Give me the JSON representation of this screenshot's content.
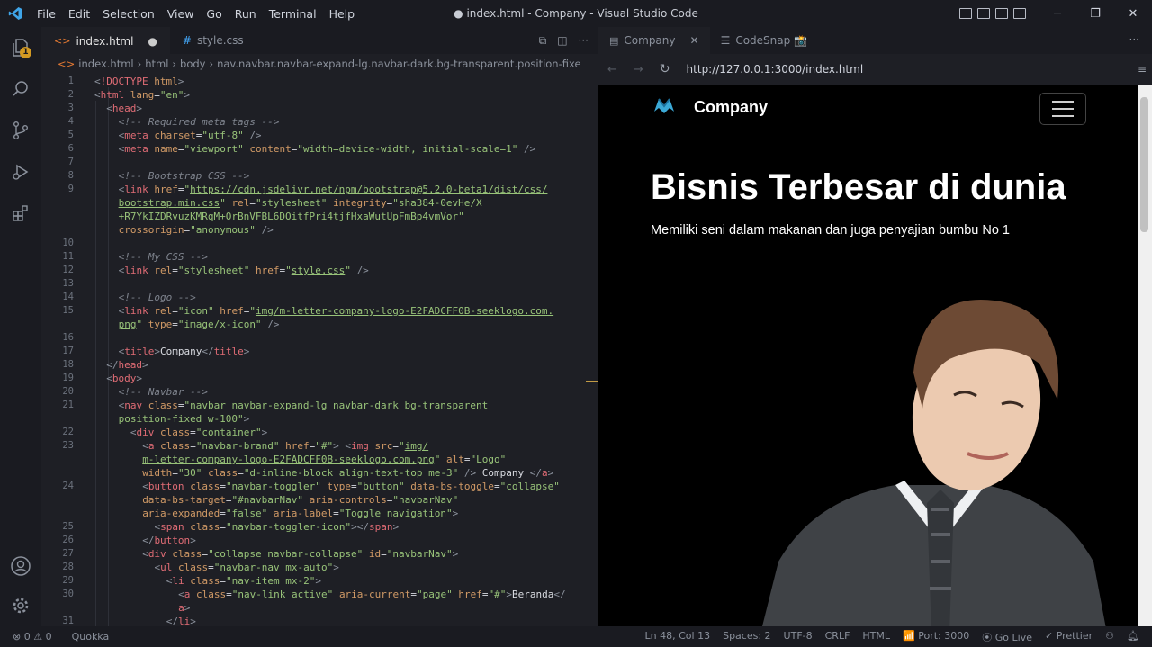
{
  "window": {
    "title": "● index.html - Company - Visual Studio Code",
    "menu": [
      "File",
      "Edit",
      "Selection",
      "View",
      "Go",
      "Run",
      "Terminal",
      "Help"
    ]
  },
  "activity": {
    "badge": "1"
  },
  "editor": {
    "tabs": [
      {
        "label": "index.html",
        "modified": "●"
      },
      {
        "label": "style.css"
      }
    ],
    "breadcrumb": [
      "index.html",
      "html",
      "body",
      "nav.navbar.navbar-expand-lg.navbar-dark.bg-transparent.position-fixe"
    ],
    "lines": [
      {
        "n": "1",
        "html": "<span class='p'>&lt;</span><span class='t'>!DOCTYPE</span> <span class='a'>html</span><span class='p'>&gt;</span>",
        "i": 0
      },
      {
        "n": "2",
        "html": "<span class='p'>&lt;</span><span class='t'>html</span> <span class='a'>lang</span>=<span class='s'>\"en\"</span><span class='p'>&gt;</span>",
        "i": 0
      },
      {
        "n": "3",
        "html": "<span class='p'>&lt;</span><span class='t'>head</span><span class='p'>&gt;</span>",
        "i": 1
      },
      {
        "n": "4",
        "html": "<span class='c'>&lt;!-- Required meta tags --&gt;</span>",
        "i": 2
      },
      {
        "n": "5",
        "html": "<span class='p'>&lt;</span><span class='t'>meta</span> <span class='a'>charset</span>=<span class='s'>\"utf-8\"</span> <span class='p'>/&gt;</span>",
        "i": 2
      },
      {
        "n": "6",
        "html": "<span class='p'>&lt;</span><span class='t'>meta</span> <span class='a'>name</span>=<span class='s'>\"viewport\"</span> <span class='a'>content</span>=<span class='s'>\"width=device-width, initial-scale=1\"</span> <span class='p'>/&gt;</span>",
        "i": 2
      },
      {
        "n": "7",
        "html": "",
        "i": 2
      },
      {
        "n": "8",
        "html": "<span class='c'>&lt;!-- Bootstrap CSS --&gt;</span>",
        "i": 2
      },
      {
        "n": "9",
        "html": "<span class='p'>&lt;</span><span class='t'>link</span> <span class='a'>href</span>=<span class='s'>\"</span><span class='u'>https://cdn.jsdelivr.net/npm/bootstrap@5.2.0-beta1/dist/css/</span>",
        "i": 2
      },
      {
        "n": "",
        "html": "<span class='u'>bootstrap.min.css</span><span class='s'>\"</span> <span class='a'>rel</span>=<span class='s'>\"stylesheet\"</span> <span class='a'>integrity</span>=<span class='s'>\"sha384-0evHe/X</span>",
        "i": 2
      },
      {
        "n": "",
        "html": "<span class='s'>+R7YkIZDRvuzKMRqM+OrBnVFBL6DOitfPri4tjfHxaWutUpFmBp4vmVor\"</span>",
        "i": 2
      },
      {
        "n": "",
        "html": "<span class='a'>crossorigin</span>=<span class='s'>\"anonymous\"</span> <span class='p'>/&gt;</span>",
        "i": 2
      },
      {
        "n": "10",
        "html": "",
        "i": 2
      },
      {
        "n": "11",
        "html": "<span class='c'>&lt;!-- My CSS --&gt;</span>",
        "i": 2
      },
      {
        "n": "12",
        "html": "<span class='p'>&lt;</span><span class='t'>link</span> <span class='a'>rel</span>=<span class='s'>\"stylesheet\"</span> <span class='a'>href</span>=<span class='s'>\"</span><span class='u'>style.css</span><span class='s'>\"</span> <span class='p'>/&gt;</span>",
        "i": 2
      },
      {
        "n": "13",
        "html": "",
        "i": 2
      },
      {
        "n": "14",
        "html": "<span class='c'>&lt;!-- Logo --&gt;</span>",
        "i": 2
      },
      {
        "n": "15",
        "html": "<span class='p'>&lt;</span><span class='t'>link</span> <span class='a'>rel</span>=<span class='s'>\"icon\"</span> <span class='a'>href</span>=<span class='s'>\"</span><span class='u'>img/m-letter-company-logo-E2FADCFF0B-seeklogo.com.</span>",
        "i": 2
      },
      {
        "n": "",
        "html": "<span class='u'>png</span><span class='s'>\"</span> <span class='a'>type</span>=<span class='s'>\"image/x-icon\"</span> <span class='p'>/&gt;</span>",
        "i": 2
      },
      {
        "n": "16",
        "html": "",
        "i": 2
      },
      {
        "n": "17",
        "html": "<span class='p'>&lt;</span><span class='t'>title</span><span class='p'>&gt;</span>Company<span class='p'>&lt;/</span><span class='t'>title</span><span class='p'>&gt;</span>",
        "i": 2
      },
      {
        "n": "18",
        "html": "<span class='p'>&lt;/</span><span class='t'>head</span><span class='p'>&gt;</span>",
        "i": 1
      },
      {
        "n": "19",
        "html": "<span class='p'>&lt;</span><span class='t'>body</span><span class='p'>&gt;</span>",
        "i": 1
      },
      {
        "n": "20",
        "html": "<span class='c'>&lt;!-- Navbar --&gt;</span>",
        "i": 2
      },
      {
        "n": "21",
        "html": "<span class='p'>&lt;</span><span class='t'>nav</span> <span class='a'>class</span>=<span class='s'>\"navbar navbar-expand-lg navbar-dark bg-transparent</span>",
        "i": 2
      },
      {
        "n": "",
        "html": "<span class='s'>position-fixed w-100\"</span><span class='p'>&gt;</span>",
        "i": 2
      },
      {
        "n": "22",
        "html": "<span class='p'>&lt;</span><span class='t'>div</span> <span class='a'>class</span>=<span class='s'>\"container\"</span><span class='p'>&gt;</span>",
        "i": 3
      },
      {
        "n": "23",
        "html": "<span class='p'>&lt;</span><span class='t'>a</span> <span class='a'>class</span>=<span class='s'>\"navbar-brand\"</span> <span class='a'>href</span>=<span class='s'>\"#\"</span><span class='p'>&gt;</span> <span class='p'>&lt;</span><span class='t'>img</span> <span class='a'>src</span>=<span class='s'>\"</span><span class='u'>img/</span>",
        "i": 4
      },
      {
        "n": "",
        "html": "<span class='u'>m-letter-company-logo-E2FADCFF0B-seeklogo.com.png</span><span class='s'>\"</span> <span class='a'>alt</span>=<span class='s'>\"Logo\"</span>",
        "i": 4
      },
      {
        "n": "",
        "html": "<span class='a'>width</span>=<span class='s'>\"30\"</span> <span class='a'>class</span>=<span class='s'>\"d-inline-block align-text-top me-3\"</span> <span class='p'>/&gt;</span> Company <span class='p'>&lt;/</span><span class='t'>a</span><span class='p'>&gt;</span>",
        "i": 4
      },
      {
        "n": "24",
        "html": "<span class='p'>&lt;</span><span class='t'>button</span> <span class='a'>class</span>=<span class='s'>\"navbar-toggler\"</span> <span class='a'>type</span>=<span class='s'>\"button\"</span> <span class='a'>data-bs-toggle</span>=<span class='s'>\"collapse\"</span>",
        "i": 4
      },
      {
        "n": "",
        "html": "<span class='a'>data-bs-target</span>=<span class='s'>\"#navbarNav\"</span> <span class='a'>aria-controls</span>=<span class='s'>\"navbarNav\"</span>",
        "i": 4
      },
      {
        "n": "",
        "html": "<span class='a'>aria-expanded</span>=<span class='s'>\"false\"</span> <span class='a'>aria-label</span>=<span class='s'>\"Toggle navigation\"</span><span class='p'>&gt;</span>",
        "i": 4
      },
      {
        "n": "25",
        "html": "<span class='p'>&lt;</span><span class='t'>span</span> <span class='a'>class</span>=<span class='s'>\"navbar-toggler-icon\"</span><span class='p'>&gt;&lt;/</span><span class='t'>span</span><span class='p'>&gt;</span>",
        "i": 5
      },
      {
        "n": "26",
        "html": "<span class='p'>&lt;/</span><span class='t'>button</span><span class='p'>&gt;</span>",
        "i": 4
      },
      {
        "n": "27",
        "html": "<span class='p'>&lt;</span><span class='t'>div</span> <span class='a'>class</span>=<span class='s'>\"collapse navbar-collapse\"</span> <span class='a'>id</span>=<span class='s'>\"navbarNav\"</span><span class='p'>&gt;</span>",
        "i": 4
      },
      {
        "n": "28",
        "html": "<span class='p'>&lt;</span><span class='t'>ul</span> <span class='a'>class</span>=<span class='s'>\"navbar-nav mx-auto\"</span><span class='p'>&gt;</span>",
        "i": 5
      },
      {
        "n": "29",
        "html": "<span class='p'>&lt;</span><span class='t'>li</span> <span class='a'>class</span>=<span class='s'>\"nav-item mx-2\"</span><span class='p'>&gt;</span>",
        "i": 6
      },
      {
        "n": "30",
        "html": "<span class='p'>&lt;</span><span class='t'>a</span> <span class='a'>class</span>=<span class='s'>\"nav-link active\"</span> <span class='a'>aria-current</span>=<span class='s'>\"page\"</span> <span class='a'>href</span>=<span class='s'>\"#\"</span><span class='p'>&gt;</span>Beranda<span class='p'>&lt;/</span>",
        "i": 7
      },
      {
        "n": "",
        "html": "<span class='t'>a</span><span class='p'>&gt;</span>",
        "i": 7
      },
      {
        "n": "31",
        "html": "<span class='p'>&lt;/</span><span class='t'>li</span><span class='p'>&gt;</span>",
        "i": 6
      }
    ]
  },
  "preview": {
    "tabs": [
      {
        "label": "Company"
      },
      {
        "label": "CodeSnap 📸"
      }
    ],
    "url": "http://127.0.0.1:3000/index.html",
    "site": {
      "brand": "Company",
      "heading": "Bisnis Terbesar di dunia",
      "subtitle": "Memiliki seni dalam makanan dan juga penyajian bumbu No 1"
    }
  },
  "statusbar": {
    "problems": "⊗ 0 ⚠ 0",
    "quokka": "Quokka",
    "position": "Ln 48, Col 13",
    "spaces": "Spaces: 2",
    "encoding": "UTF-8",
    "eol": "CRLF",
    "language": "HTML",
    "port": "Port: 3000",
    "golive": "Go Live",
    "prettier": "Prettier"
  },
  "colors": {
    "accent": "#007acc",
    "background": "#1e1f25",
    "string": "#98c379",
    "tag": "#e06c75",
    "attr": "#d19a66"
  }
}
